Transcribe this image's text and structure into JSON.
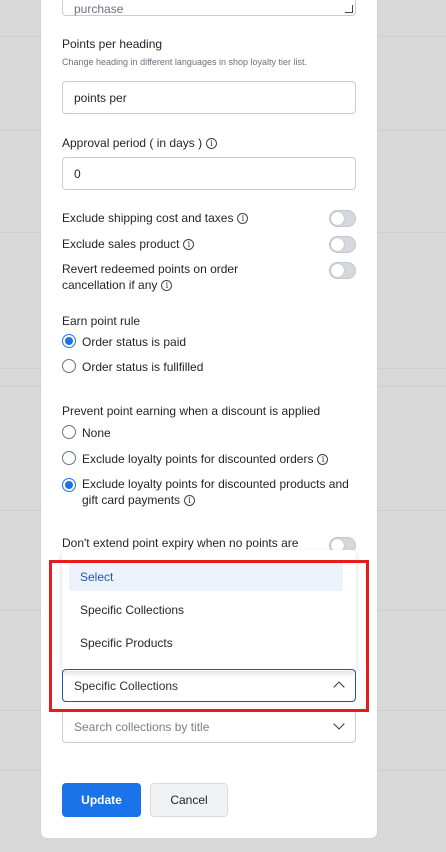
{
  "form": {
    "top_textarea_value": "purchase",
    "points_heading_label": "Points per heading",
    "points_heading_hint": "Change heading in different languages in shop loyalty tier list.",
    "points_heading_value": "points per",
    "approval_label": "Approval period ( in days )",
    "approval_value": "0",
    "exclude_shipping_label": "Exclude shipping cost and taxes",
    "exclude_sales_label": "Exclude sales product",
    "revert_label_line1": "Revert redeemed points on order",
    "revert_label_line2": "cancellation if any",
    "earn_rule_label": "Earn point rule",
    "earn_options": [
      "Order status is paid",
      "Order status is fullfilled"
    ],
    "prevent_label": "Prevent point earning when a discount is applied",
    "prevent_options": [
      "None",
      "Exclude loyalty points for discounted orders"
    ],
    "prevent_option3_line1": "Exclude loyalty points for discounted products and",
    "prevent_option3_line2": "gift card payments",
    "extend_label": "Don't extend point expiry when no points are"
  },
  "dropdown": {
    "options": [
      "Select",
      "Specific Collections",
      "Specific Products"
    ],
    "selected_value": "Specific Collections",
    "search_placeholder": "Search collections by title"
  },
  "actions": {
    "update_label": "Update",
    "cancel_label": "Cancel"
  },
  "icons": {
    "info": "info-icon",
    "chevron": "chevron-icon"
  },
  "colors": {
    "accent": "#1a73e8",
    "highlight": "#e61c1c"
  }
}
